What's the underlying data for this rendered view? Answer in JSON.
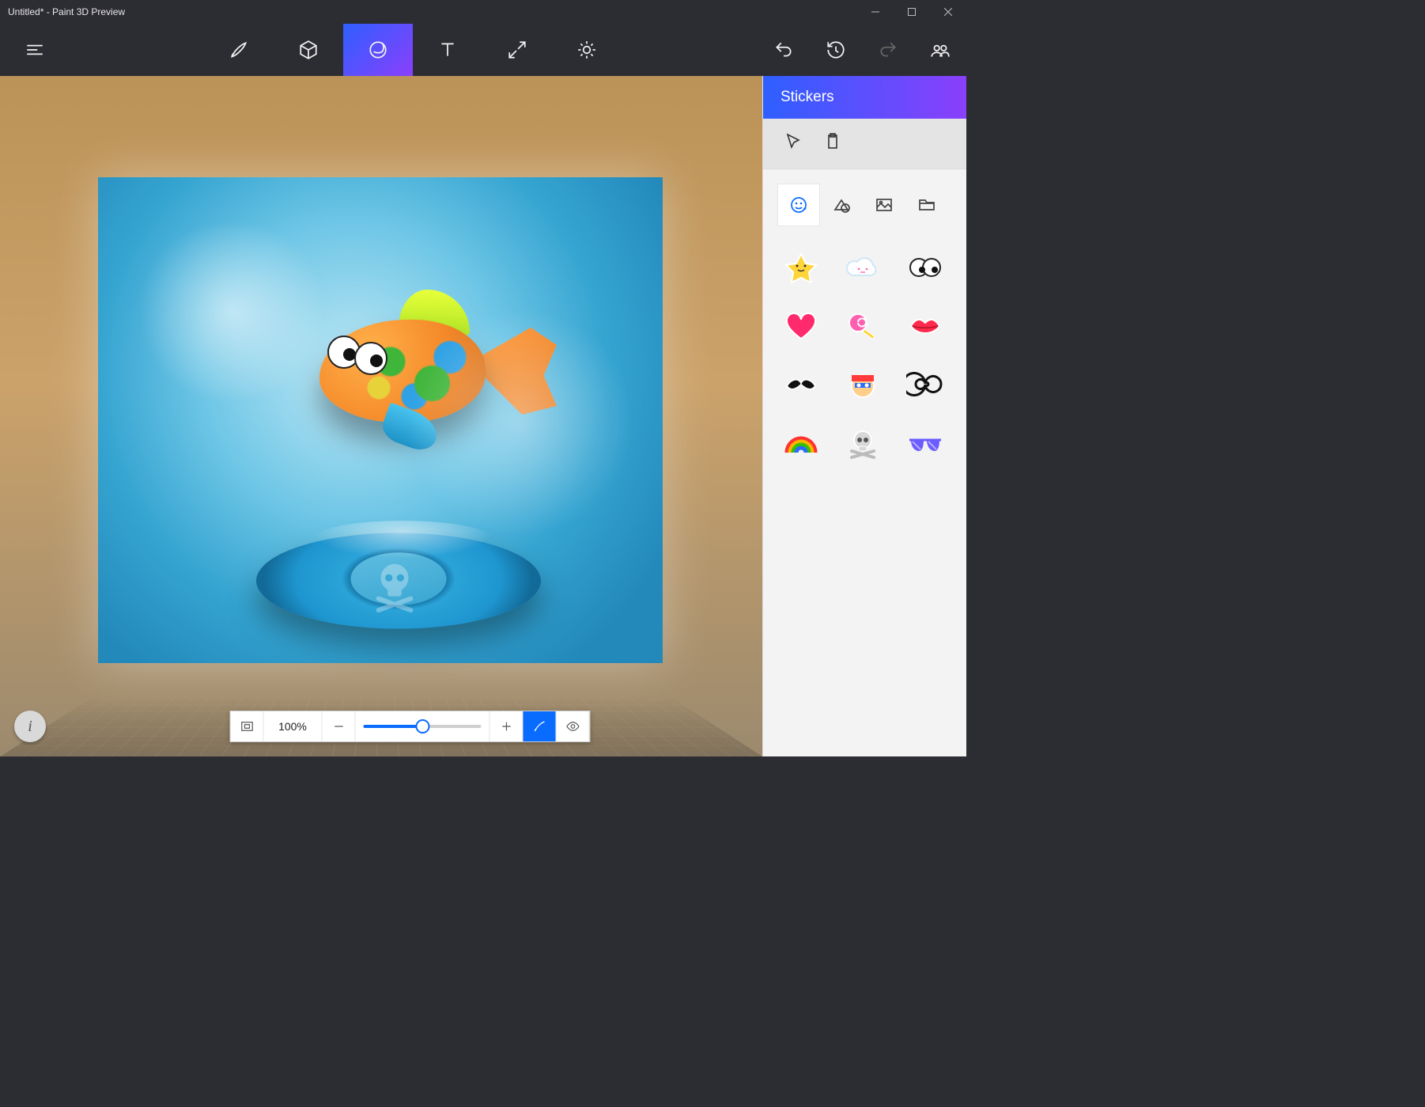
{
  "window": {
    "title": "Untitled* - Paint 3D Preview"
  },
  "toolbar": {
    "items": [
      "menu",
      "brush",
      "3d",
      "stickers",
      "text",
      "canvas",
      "effects"
    ],
    "selected": "stickers"
  },
  "history": {
    "undo": true,
    "history": true,
    "redo_disabled": true,
    "community": true
  },
  "sidebar": {
    "title": "Stickers",
    "tool_buttons": [
      "select",
      "paste"
    ],
    "categories": [
      "stickers",
      "shapes",
      "textures",
      "browse"
    ],
    "selected_category": "stickers",
    "stickers": [
      "star",
      "cloud",
      "eyes",
      "heart",
      "lollipop",
      "lips",
      "mustache",
      "face",
      "spiral",
      "rainbow",
      "skull",
      "sunglasses"
    ]
  },
  "zoombar": {
    "percent_label": "100%",
    "slider_value": 50
  },
  "canvas": {
    "info_label": "i"
  }
}
